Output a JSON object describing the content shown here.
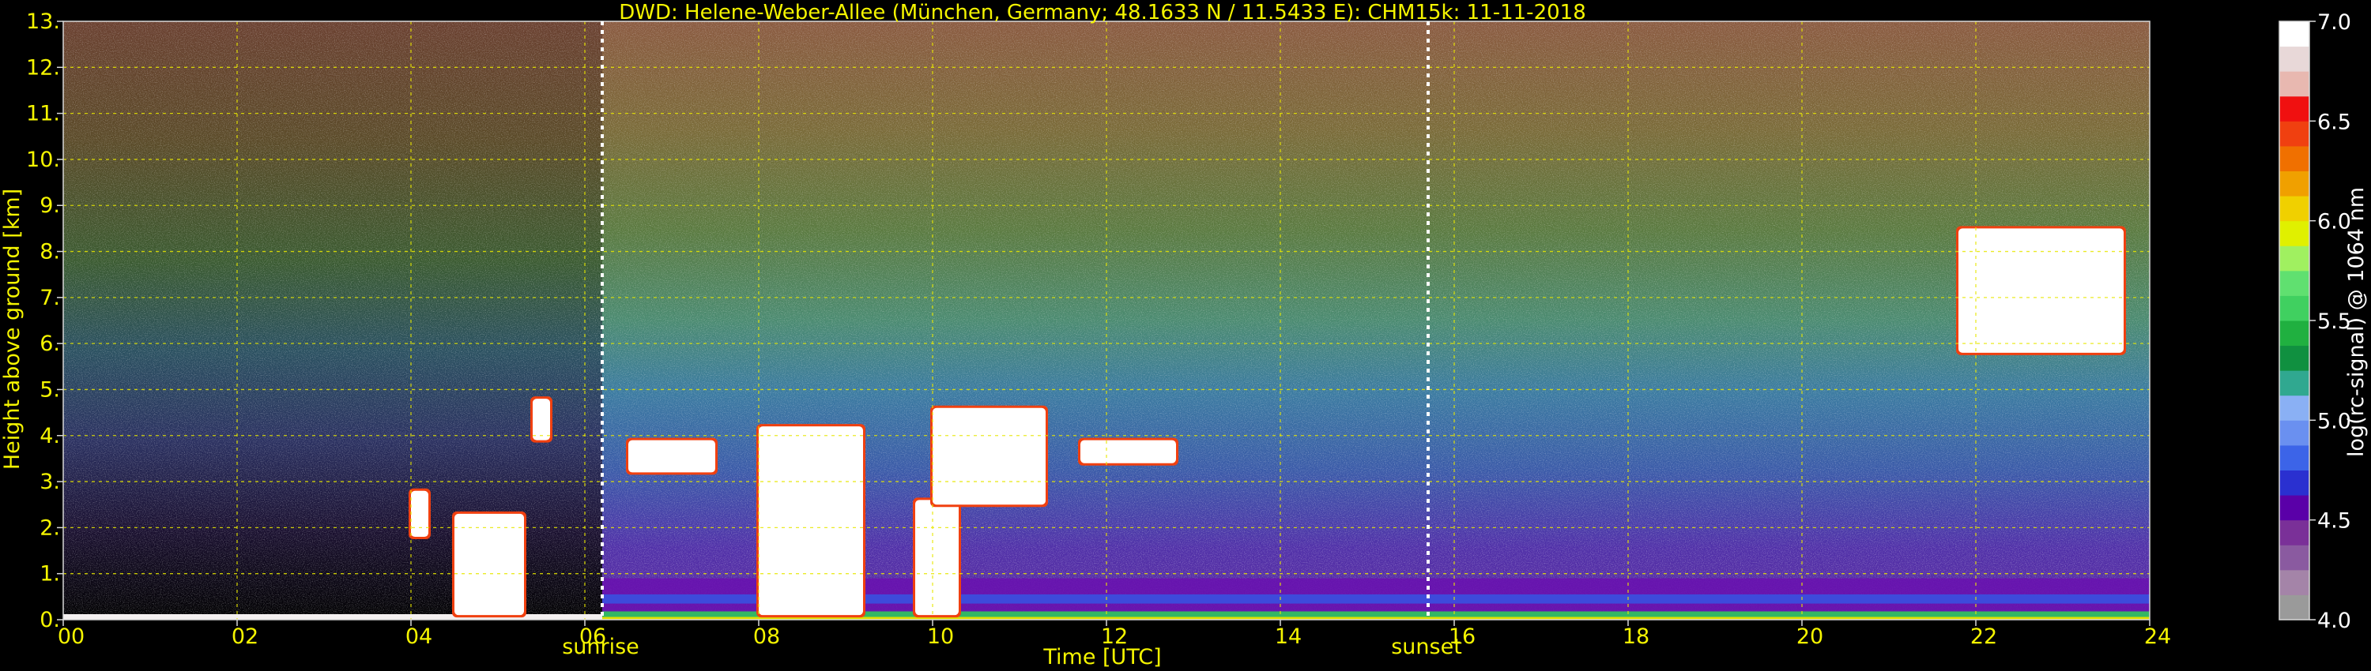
{
  "chart_data": {
    "type": "heatmap",
    "title": "DWD: Helene-Weber-Allee (München, Germany; 48.1633 N / 11.5433 E):    CHM15k: 11-11-2018",
    "xlabel": "Time [UTC]",
    "ylabel": "Height above ground [km]",
    "xlim": [
      0,
      24
    ],
    "ylim": [
      0,
      13
    ],
    "x_ticks": [
      0,
      2,
      4,
      6,
      8,
      10,
      12,
      14,
      16,
      18,
      20,
      22,
      24
    ],
    "x_tick_labels": [
      "00",
      "02",
      "04",
      "06",
      "08",
      "10",
      "12",
      "14",
      "16",
      "18",
      "20",
      "22",
      "24"
    ],
    "y_ticks": [
      0,
      1,
      2,
      3,
      4,
      5,
      6,
      7,
      8,
      9,
      10,
      11,
      12,
      13
    ],
    "y_tick_labels": [
      "0.",
      "1.",
      "2.",
      "3.",
      "4.",
      "5.",
      "6.",
      "7.",
      "8.",
      "9.",
      "10.",
      "11.",
      "12.",
      "13."
    ],
    "grid": true,
    "grid_color": "#e8e800",
    "annotations": [
      {
        "label": "sunrise",
        "x": 6.2
      },
      {
        "label": "sunset",
        "x": 15.7
      }
    ],
    "colorbar": {
      "label": "log(rc-signal) @ 1064 nm",
      "range": [
        4.0,
        7.0
      ],
      "ticks": [
        4.0,
        4.5,
        5.0,
        5.5,
        6.0,
        6.5,
        7.0
      ],
      "tick_labels": [
        "4.0",
        "4.5",
        "5.0",
        "5.5",
        "6.0",
        "6.5",
        "7.0"
      ],
      "colors": [
        "#9a9a9a",
        "#a484a8",
        "#8a5aa0",
        "#7a3098",
        "#5a00a8",
        "#2a30d0",
        "#3c64e8",
        "#6a90f0",
        "#8ab0f4",
        "#30a890",
        "#109040",
        "#20b040",
        "#40d060",
        "#60e070",
        "#a0f060",
        "#e0f000",
        "#f0d000",
        "#f0a000",
        "#f07000",
        "#f04010",
        "#f01010",
        "#e8b8b0",
        "#e8d8d8",
        "#ffffff"
      ]
    },
    "features": [
      {
        "kind": "boundary-layer",
        "x_range": [
          6.2,
          24
        ],
        "height_km": 0.9
      },
      {
        "kind": "cloud",
        "x_range": [
          4.0,
          4.2
        ],
        "y_range": [
          1.8,
          2.8
        ]
      },
      {
        "kind": "cloud",
        "x_range": [
          4.5,
          5.3
        ],
        "y_range": [
          0.1,
          2.3
        ]
      },
      {
        "kind": "cloud",
        "x_range": [
          5.4,
          5.6
        ],
        "y_range": [
          3.9,
          4.8
        ]
      },
      {
        "kind": "cloud",
        "x_range": [
          6.5,
          7.5
        ],
        "y_range": [
          3.2,
          3.9
        ]
      },
      {
        "kind": "cloud",
        "x_range": [
          8.0,
          9.2
        ],
        "y_range": [
          0.1,
          4.2
        ]
      },
      {
        "kind": "cloud",
        "x_range": [
          9.8,
          10.3
        ],
        "y_range": [
          0.1,
          2.6
        ]
      },
      {
        "kind": "cloud",
        "x_range": [
          10.0,
          11.3
        ],
        "y_range": [
          2.5,
          4.6
        ]
      },
      {
        "kind": "cloud",
        "x_range": [
          11.7,
          12.8
        ],
        "y_range": [
          3.4,
          3.9
        ]
      },
      {
        "kind": "cloud",
        "x_range": [
          21.8,
          23.7
        ],
        "y_range": [
          5.8,
          8.5
        ]
      }
    ]
  }
}
